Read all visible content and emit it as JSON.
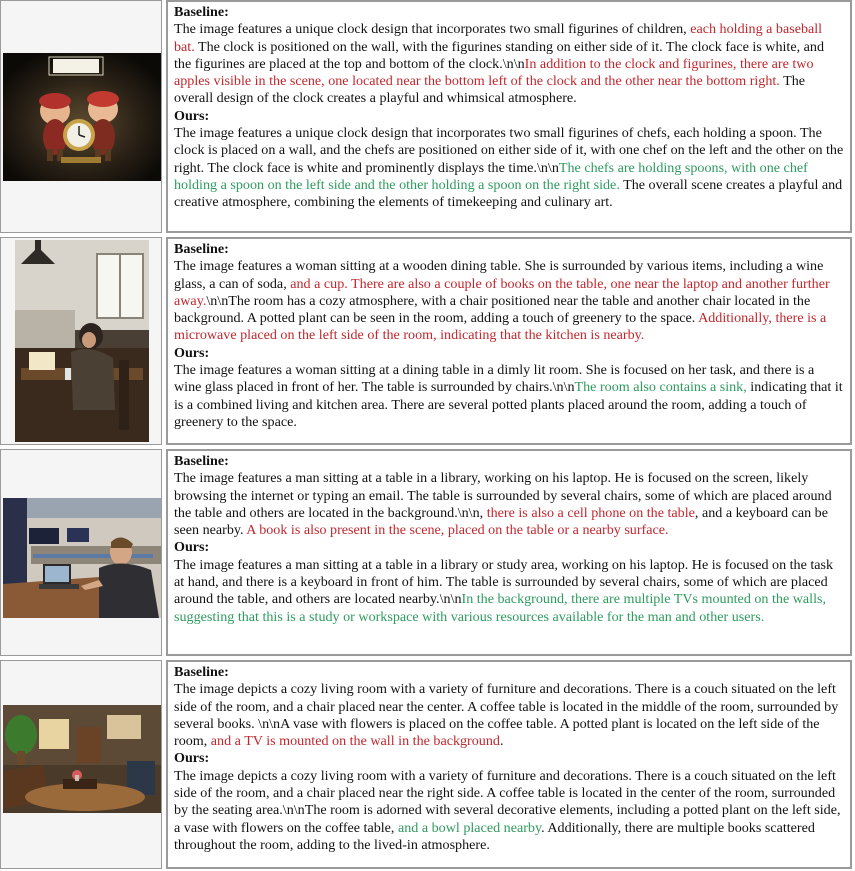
{
  "colors": {
    "hallucination": "#c0272d",
    "correct": "#2e9a5e",
    "border": "#9a9a9a"
  },
  "labels": {
    "baseline": "Baseline:",
    "ours": "Ours:"
  },
  "examples": [
    {
      "image": "clock-figurines-photo",
      "baseline": [
        {
          "t": "The image features a unique clock design that incorporates two small figurines of children, ",
          "c": ""
        },
        {
          "t": "each holding a baseball bat.",
          "c": "red"
        },
        {
          "t": " The clock is positioned on the wall, with the figurines standing on either side of it. The clock face is white, and the figurines are placed at the top and bottom of the clock.\\n\\n",
          "c": ""
        },
        {
          "t": "In addition to the clock and figurines, there are two apples visible in the scene, one located near the bottom left of the clock and the other near the bottom right.",
          "c": "red"
        },
        {
          "t": " The overall design of the clock creates a playful and whimsical atmosphere.",
          "c": ""
        }
      ],
      "ours": [
        {
          "t": "The image features a unique clock design that incorporates two small figurines of chefs, each holding a spoon. The clock is placed on a wall, and the chefs are positioned on either side of it, with one chef on the left and the other on the right. The clock face is white and prominently displays the time.\\n\\n",
          "c": ""
        },
        {
          "t": "The chefs are holding spoons, with one chef holding a spoon on the left side and the other holding a spoon on the right side.",
          "c": "green"
        },
        {
          "t": " The overall scene creates a playful and creative atmosphere, combining the elements of timekeeping and culinary art.",
          "c": ""
        }
      ]
    },
    {
      "image": "woman-dining-table-photo",
      "baseline": [
        {
          "t": "The image features a woman sitting at a wooden dining table. She is surrounded by various items, including a wine glass, a can of soda, ",
          "c": ""
        },
        {
          "t": "and a cup. There are also a couple of books on the table, one near the laptop and another further away.",
          "c": "red"
        },
        {
          "t": "\\n\\nThe room has a cozy atmosphere, with a chair positioned near the table and another chair located in the background. A potted plant can be seen in the room, adding a touch of greenery to the space. ",
          "c": ""
        },
        {
          "t": "Additionally, there is a microwave placed on the left side of the room, indicating that the kitchen is nearby.",
          "c": "red"
        }
      ],
      "ours": [
        {
          "t": "The image features a woman sitting at a dining table in a dimly lit room. She is focused on her task, and there is a wine glass placed in front of her. The table is surrounded by chairs.\\n\\n",
          "c": ""
        },
        {
          "t": "The room also contains a sink,",
          "c": "green"
        },
        {
          "t": " indicating that it is a combined living and kitchen area. There are several potted plants placed around the room, adding a touch of greenery to the space.",
          "c": ""
        }
      ]
    },
    {
      "image": "man-library-laptop-photo",
      "baseline": [
        {
          "t": "The image features a man sitting at a table in a library, working on his laptop. He is focused on the screen, likely browsing the internet or typing an email. The table is surrounded by several chairs, some of which are placed around the table and others are located in the background.\\n\\n, ",
          "c": ""
        },
        {
          "t": "there is also  a cell phone on the table",
          "c": "red"
        },
        {
          "t": ", and a keyboard can be seen nearby. ",
          "c": ""
        },
        {
          "t": "A book is also present in the scene, placed on the table or a nearby surface.",
          "c": "red"
        }
      ],
      "ours": [
        {
          "t": "The image features a man sitting at a table in a library or study area, working on his laptop. He is focused on the task at hand, and there is a keyboard in front of him. The table is surrounded by several chairs, some of which are placed around the table, and others are located nearby.\\n\\n",
          "c": ""
        },
        {
          "t": "In the background, there are multiple TVs mounted on the walls, suggesting that this is a study or workspace with various resources available for the man and other users.",
          "c": "green"
        }
      ]
    },
    {
      "image": "living-room-photo",
      "baseline": [
        {
          "t": "The image depicts a cozy living room with a variety of furniture and decorations. There is a couch situated on the left side of the room, and a chair placed near the center. A coffee table is located in the middle of the room, surrounded by several books. \\n\\nA vase with flowers is placed on the coffee table. A potted plant is located on the left side of the room, ",
          "c": ""
        },
        {
          "t": "and a TV is mounted on the wall in the background",
          "c": "red"
        },
        {
          "t": ".",
          "c": ""
        }
      ],
      "ours": [
        {
          "t": "The image depicts a cozy living room with a variety of furniture and decorations. There is a couch situated on the left side of the room, and a chair placed near the right side. A coffee table is located in the center of the room, surrounded by the seating area.\\n\\nThe room is adorned with several decorative elements, including a potted plant on the left side, a vase with flowers on the coffee table, ",
          "c": ""
        },
        {
          "t": "and a bowl placed nearby",
          "c": "green"
        },
        {
          "t": ". Additionally, there are multiple books scattered throughout the room, adding to the lived-in atmosphere.",
          "c": ""
        }
      ]
    }
  ]
}
